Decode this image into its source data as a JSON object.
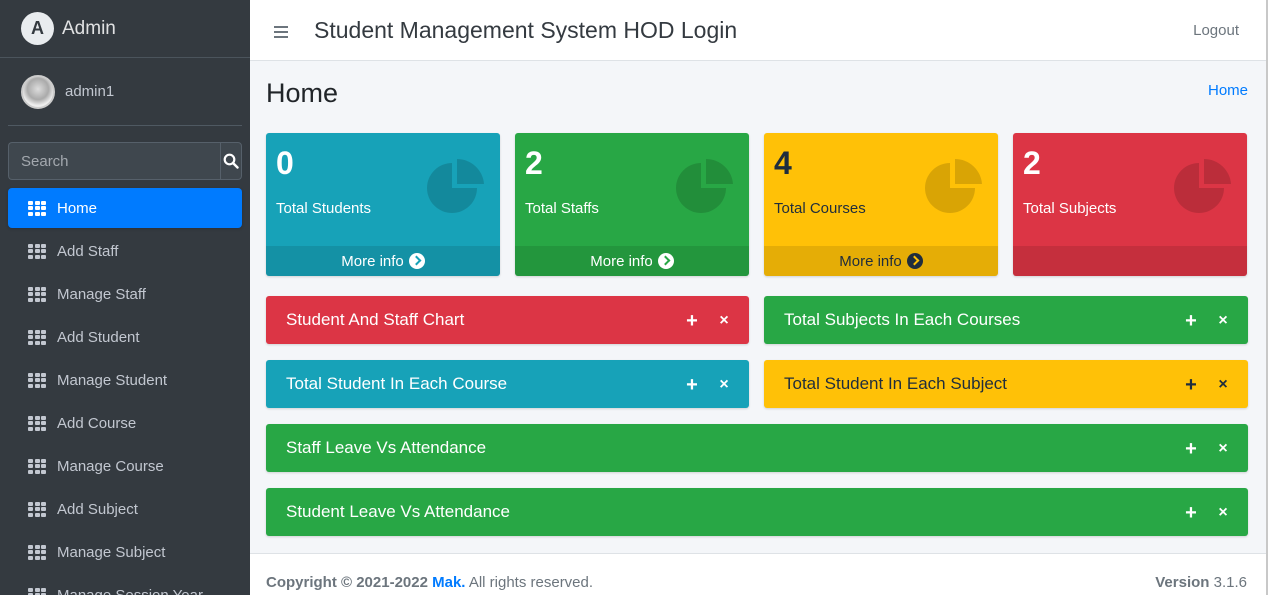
{
  "sidebar": {
    "brand": "Admin",
    "brand_logo_letter": "A",
    "user_name": "admin1",
    "search_placeholder": "Search",
    "items": [
      {
        "label": "Home",
        "active": true
      },
      {
        "label": "Add Staff"
      },
      {
        "label": "Manage Staff"
      },
      {
        "label": "Add Student"
      },
      {
        "label": "Manage Student"
      },
      {
        "label": "Add Course"
      },
      {
        "label": "Manage Course"
      },
      {
        "label": "Add Subject"
      },
      {
        "label": "Manage Subject"
      },
      {
        "label": "Manage Session Year"
      }
    ]
  },
  "header": {
    "title": "Student Management System HOD Login",
    "logout": "Logout"
  },
  "content": {
    "page_title": "Home",
    "breadcrumb": "Home",
    "stats": [
      {
        "value": "0",
        "label": "Total Students",
        "footer": "More info",
        "color": "#17a2b8"
      },
      {
        "value": "2",
        "label": "Total Staffs",
        "footer": "More info",
        "color": "#28a745"
      },
      {
        "value": "4",
        "label": "Total Courses",
        "footer": "More info",
        "color": "#ffc107"
      },
      {
        "value": "2",
        "label": "Total Subjects",
        "footer": "",
        "color": "#dc3545"
      }
    ],
    "cards": [
      {
        "title": "Student And Staff Chart",
        "color": "#dc3545"
      },
      {
        "title": "Total Subjects In Each Courses",
        "color": "#28a745"
      },
      {
        "title": "Total Student In Each Course",
        "color": "#17a2b8"
      },
      {
        "title": "Total Student In Each Subject",
        "color": "#ffc107"
      },
      {
        "title": "Staff Leave Vs Attendance",
        "color": "#28a745"
      },
      {
        "title": "Student Leave Vs Attendance",
        "color": "#28a745"
      }
    ],
    "tools": {
      "expand": "+",
      "close": "×"
    }
  },
  "footer": {
    "copyright": "Copyright © 2021-2022 ",
    "brand": "Mak.",
    "rights": " All rights reserved.",
    "version_label": "Version",
    "version": "3.1.6"
  }
}
